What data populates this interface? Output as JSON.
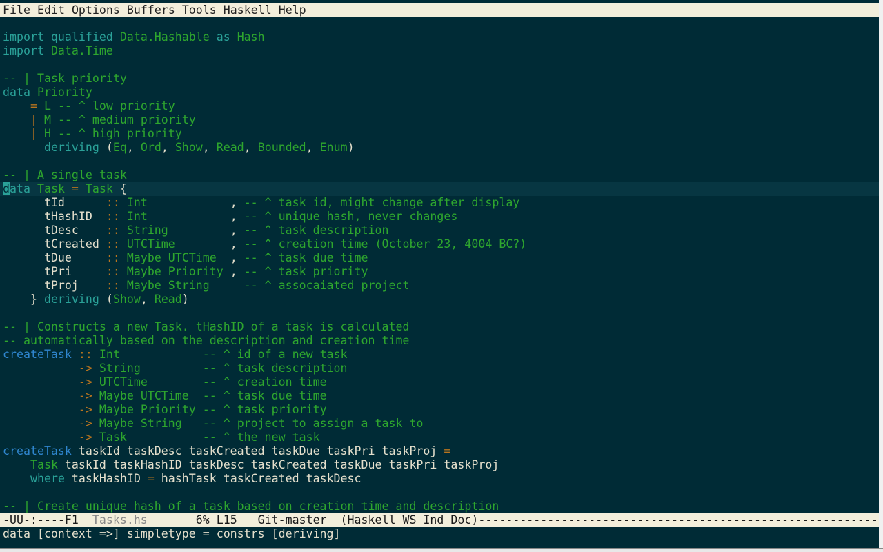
{
  "menu": [
    "File",
    "Edit",
    "Options",
    "Buffers",
    "Tools",
    "Haskell",
    "Help"
  ],
  "colors": {
    "background": "#002b36",
    "keyword": "#2aa198",
    "type_comment": "#2ea62e",
    "operator": "#b8741f",
    "function": "#2f86cf",
    "text": "#e4dfcc",
    "current_line": "#073642"
  },
  "current_line": 12,
  "lines": [
    [],
    [
      [
        "k",
        "import qualified "
      ],
      [
        "g",
        "Data.Hashable"
      ],
      [
        "k",
        " as "
      ],
      [
        "g",
        "Hash"
      ]
    ],
    [
      [
        "k",
        "import "
      ],
      [
        "g",
        "Data.Time"
      ]
    ],
    [],
    [
      [
        "g",
        "-- | Task priority"
      ]
    ],
    [
      [
        "k",
        "data "
      ],
      [
        "g",
        "Priority"
      ]
    ],
    [
      [
        "n",
        "    "
      ],
      [
        "o",
        "="
      ],
      [
        "g",
        " L -- ^ low priority"
      ]
    ],
    [
      [
        "n",
        "    "
      ],
      [
        "o",
        "|"
      ],
      [
        "g",
        " M -- ^ medium priority"
      ]
    ],
    [
      [
        "n",
        "    "
      ],
      [
        "o",
        "|"
      ],
      [
        "g",
        " H -- ^ high priority"
      ]
    ],
    [
      [
        "n",
        "      "
      ],
      [
        "k",
        "deriving"
      ],
      [
        "n",
        " ("
      ],
      [
        "g",
        "Eq"
      ],
      [
        "n",
        ", "
      ],
      [
        "g",
        "Ord"
      ],
      [
        "n",
        ", "
      ],
      [
        "g",
        "Show"
      ],
      [
        "n",
        ", "
      ],
      [
        "g",
        "Read"
      ],
      [
        "n",
        ", "
      ],
      [
        "g",
        "Bounded"
      ],
      [
        "n",
        ", "
      ],
      [
        "g",
        "Enum"
      ],
      [
        "n",
        ")"
      ]
    ],
    [],
    [
      [
        "g",
        "-- | A single task"
      ]
    ],
    [
      [
        "cur",
        "d"
      ],
      [
        "k",
        "ata "
      ],
      [
        "g",
        "Task"
      ],
      [
        "o",
        " = "
      ],
      [
        "g",
        "Task"
      ],
      [
        "n",
        " {"
      ]
    ],
    [
      [
        "n",
        "      tId      "
      ],
      [
        "o",
        ":: "
      ],
      [
        "g",
        "Int            "
      ],
      [
        "n",
        ", "
      ],
      [
        "g",
        "-- ^ task id, might change after display"
      ]
    ],
    [
      [
        "n",
        "      tHashID  "
      ],
      [
        "o",
        ":: "
      ],
      [
        "g",
        "Int            "
      ],
      [
        "n",
        ", "
      ],
      [
        "g",
        "-- ^ unique hash, never changes"
      ]
    ],
    [
      [
        "n",
        "      tDesc    "
      ],
      [
        "o",
        ":: "
      ],
      [
        "g",
        "String         "
      ],
      [
        "n",
        ", "
      ],
      [
        "g",
        "-- ^ task description"
      ]
    ],
    [
      [
        "n",
        "      tCreated "
      ],
      [
        "o",
        ":: "
      ],
      [
        "g",
        "UTCTime        "
      ],
      [
        "n",
        ", "
      ],
      [
        "g",
        "-- ^ creation time (October 23, 4004 BC?)"
      ]
    ],
    [
      [
        "n",
        "      tDue     "
      ],
      [
        "o",
        ":: "
      ],
      [
        "g",
        "Maybe UTCTime  "
      ],
      [
        "n",
        ", "
      ],
      [
        "g",
        "-- ^ task due time"
      ]
    ],
    [
      [
        "n",
        "      tPri     "
      ],
      [
        "o",
        ":: "
      ],
      [
        "g",
        "Maybe Priority "
      ],
      [
        "n",
        ", "
      ],
      [
        "g",
        "-- ^ task priority"
      ]
    ],
    [
      [
        "n",
        "      tProj    "
      ],
      [
        "o",
        ":: "
      ],
      [
        "g",
        "Maybe String     -- ^ assocaiated project"
      ]
    ],
    [
      [
        "n",
        "    } "
      ],
      [
        "k",
        "deriving"
      ],
      [
        "n",
        " ("
      ],
      [
        "g",
        "Show"
      ],
      [
        "n",
        ", "
      ],
      [
        "g",
        "Read"
      ],
      [
        "n",
        ")"
      ]
    ],
    [],
    [
      [
        "g",
        "-- | Constructs a new Task. tHashID of a task is calculated"
      ]
    ],
    [
      [
        "g",
        "-- automatically based on the description and creation time"
      ]
    ],
    [
      [
        "b",
        "createTask"
      ],
      [
        "o",
        " :: "
      ],
      [
        "g",
        "Int            -- ^ id of a new task"
      ]
    ],
    [
      [
        "n",
        "           "
      ],
      [
        "o",
        "-> "
      ],
      [
        "g",
        "String         -- ^ task description"
      ]
    ],
    [
      [
        "n",
        "           "
      ],
      [
        "o",
        "-> "
      ],
      [
        "g",
        "UTCTime        -- ^ creation time"
      ]
    ],
    [
      [
        "n",
        "           "
      ],
      [
        "o",
        "-> "
      ],
      [
        "g",
        "Maybe UTCTime  -- ^ task due time"
      ]
    ],
    [
      [
        "n",
        "           "
      ],
      [
        "o",
        "-> "
      ],
      [
        "g",
        "Maybe Priority -- ^ task priority"
      ]
    ],
    [
      [
        "n",
        "           "
      ],
      [
        "o",
        "-> "
      ],
      [
        "g",
        "Maybe String   -- ^ project to assign a task to"
      ]
    ],
    [
      [
        "n",
        "           "
      ],
      [
        "o",
        "-> "
      ],
      [
        "g",
        "Task           -- ^ the new task"
      ]
    ],
    [
      [
        "b",
        "createTask"
      ],
      [
        "n",
        " taskId taskDesc taskCreated taskDue taskPri taskProj "
      ],
      [
        "o",
        "="
      ]
    ],
    [
      [
        "n",
        "    "
      ],
      [
        "g",
        "Task"
      ],
      [
        "n",
        " taskId taskHashID taskDesc taskCreated taskDue taskPri taskProj"
      ]
    ],
    [
      [
        "n",
        "    "
      ],
      [
        "k",
        "where"
      ],
      [
        "n",
        " taskHashID "
      ],
      [
        "o",
        "="
      ],
      [
        "n",
        " hashTask taskCreated taskDesc"
      ]
    ],
    [],
    [
      [
        "g",
        "-- | Create unique hash of a task based on creation time and description"
      ]
    ]
  ],
  "modeline": {
    "prefix": "-UU-:----F1  ",
    "filename": "Tasks.hs",
    "position": "       6% L15   ",
    "vc": "Git-master",
    "modes": "  (Haskell WS Ind Doc)",
    "fill": "------------------------------------------------------------------------------------------------------------"
  },
  "minibuffer": "data [context =>] simpletype = constrs [deriving]"
}
